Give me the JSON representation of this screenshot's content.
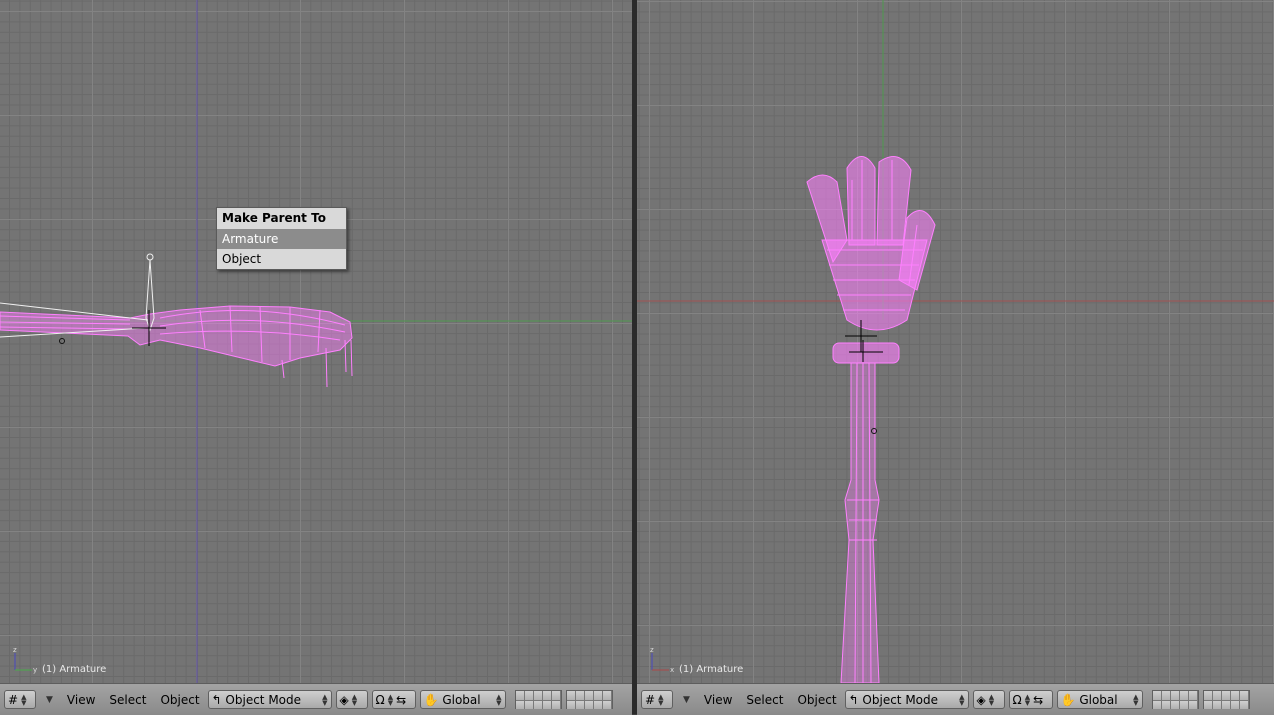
{
  "viewports": [
    {
      "status": "(1) Armature"
    },
    {
      "status": "(1) Armature"
    }
  ],
  "popup": {
    "title": "Make Parent To",
    "items": [
      "Armature",
      "Object"
    ],
    "active_index": 0
  },
  "headers": [
    {
      "menus": [
        "View",
        "Select",
        "Object"
      ],
      "mode": "Object Mode",
      "orientation": "Global"
    },
    {
      "menus": [
        "View",
        "Select",
        "Object"
      ],
      "mode": "Object Mode",
      "orientation": "Global"
    }
  ],
  "colors": {
    "mesh": "#ff80ff",
    "grid_bg": "#747474",
    "x_axis": "#a05050",
    "y_axis": "#50a050",
    "z_axis": "#5050b4"
  },
  "icons": [
    "grid-icon",
    "transform-mode-icon",
    "shading-icon",
    "magnet-icon",
    "snap-icon",
    "hand-icon"
  ]
}
